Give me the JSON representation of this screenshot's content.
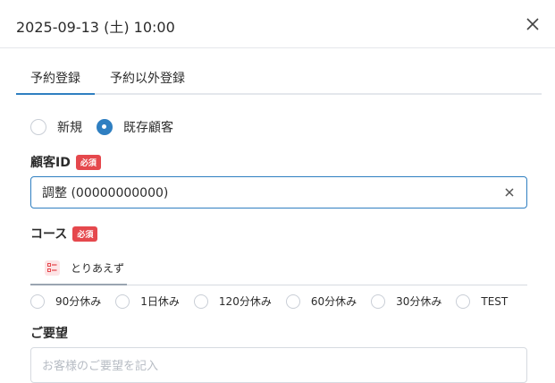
{
  "header": {
    "title": "2025-09-13 (土) 10:00"
  },
  "tabs": [
    {
      "label": "予約登録",
      "active": true
    },
    {
      "label": "予約以外登録",
      "active": false
    }
  ],
  "customer_type": {
    "options": [
      {
        "label": "新規",
        "checked": false
      },
      {
        "label": "既存顧客",
        "checked": true
      }
    ]
  },
  "customer_id": {
    "label": "顧客ID",
    "required_badge": "必須",
    "value": "調整 (00000000000)"
  },
  "course": {
    "label": "コース",
    "required_badge": "必須",
    "tab_label": "とりあえず",
    "tab_icon": "list-icon",
    "options": [
      "90分休み",
      "1日休み",
      "120分休み",
      "60分休み",
      "30分休み",
      "TEST"
    ]
  },
  "request": {
    "label": "ご要望",
    "placeholder": "お客様のご要望を記入"
  },
  "colors": {
    "accent": "#2f7fc1",
    "required": "#e5484d",
    "border": "#d6dae0"
  }
}
